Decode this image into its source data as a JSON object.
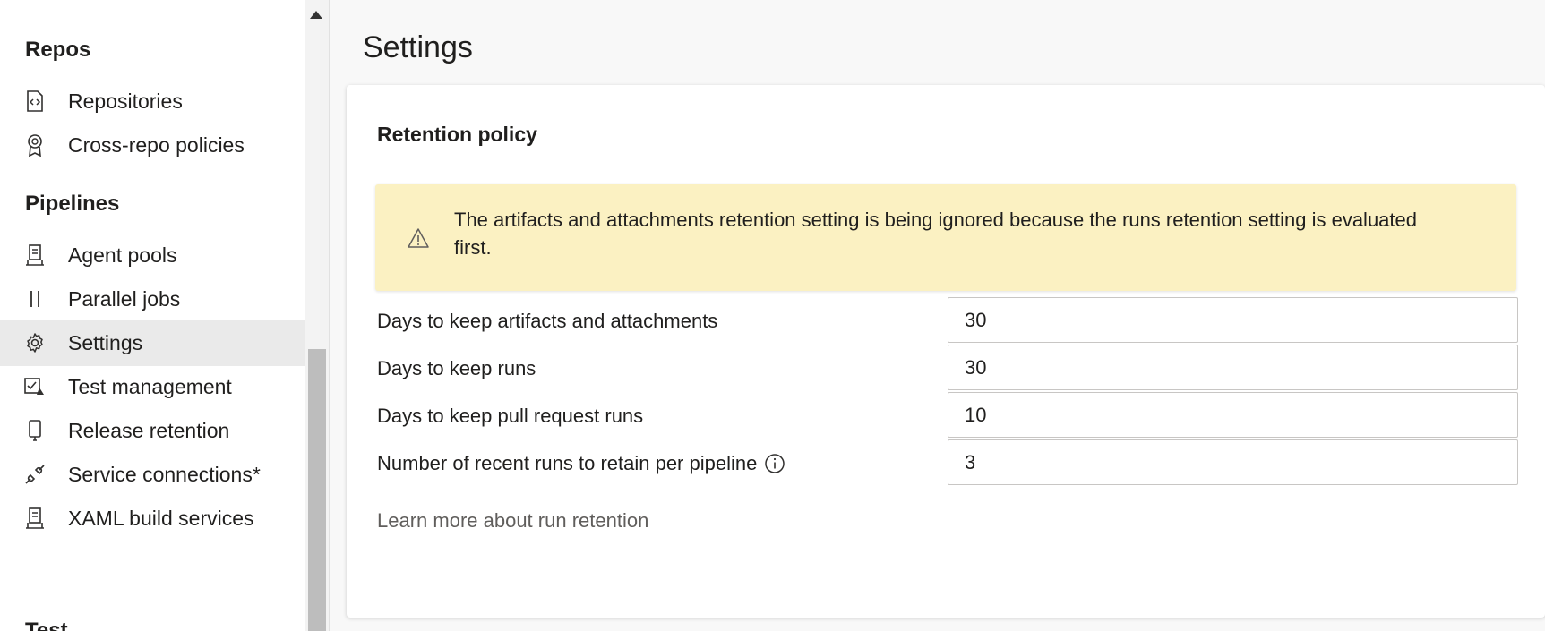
{
  "sidebar": {
    "groups": [
      {
        "title": "Repos",
        "items": [
          {
            "label": "Repositories",
            "icon": "repo-icon"
          },
          {
            "label": "Cross-repo policies",
            "icon": "policy-badge-icon"
          }
        ]
      },
      {
        "title": "Pipelines",
        "items": [
          {
            "label": "Agent pools",
            "icon": "agent-pool-icon"
          },
          {
            "label": "Parallel jobs",
            "icon": "parallel-icon"
          },
          {
            "label": "Settings",
            "icon": "gear-icon",
            "selected": true
          },
          {
            "label": "Test management",
            "icon": "test-management-icon"
          },
          {
            "label": "Release retention",
            "icon": "phone-icon"
          },
          {
            "label": "Service connections*",
            "icon": "plug-icon"
          },
          {
            "label": "XAML build services",
            "icon": "build-service-icon"
          }
        ]
      }
    ],
    "next_group_partial": "Test"
  },
  "page": {
    "title": "Settings"
  },
  "retention": {
    "title": "Retention policy",
    "warning": "The artifacts and attachments retention setting is being ignored because the runs retention setting is evaluated first.",
    "rows": [
      {
        "label": "Days to keep artifacts and attachments",
        "value": "30"
      },
      {
        "label": "Days to keep runs",
        "value": "30"
      },
      {
        "label": "Days to keep pull request runs",
        "value": "10"
      },
      {
        "label": "Number of recent runs to retain per pipeline",
        "value": "3",
        "info_icon": "info-icon"
      }
    ],
    "learn_more": "Learn more about run retention"
  },
  "colors": {
    "warning_background": "#fbf1c2",
    "selected_background": "#eaeaea",
    "main_background": "#f8f8f8"
  }
}
